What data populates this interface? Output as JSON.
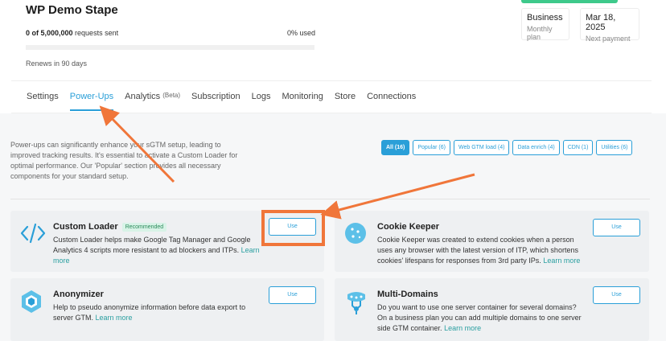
{
  "header": {
    "title": "WP Demo Stape",
    "requests_count": "0 of 5,000,000",
    "requests_suffix": " requests sent",
    "used": "0% used",
    "usage_percent": 0,
    "renews": "Renews in 90 days"
  },
  "plan_cards": [
    {
      "value": "Business",
      "label": "Monthly plan"
    },
    {
      "value": "Mar 18, 2025",
      "label": "Next payment"
    }
  ],
  "tabs": [
    {
      "label": "Settings",
      "active": false
    },
    {
      "label": "Power-Ups",
      "active": true
    },
    {
      "label": "Analytics",
      "sup": "(Beta)",
      "active": false
    },
    {
      "label": "Subscription",
      "active": false
    },
    {
      "label": "Logs",
      "active": false
    },
    {
      "label": "Monitoring",
      "active": false
    },
    {
      "label": "Store",
      "active": false
    },
    {
      "label": "Connections",
      "active": false
    }
  ],
  "intro": "Power-ups can significantly enhance your sGTM setup, leading to improved tracking results. It's essential to activate a Custom Loader for optimal performance. Our 'Popular' section provides all necessary components for your standard setup.",
  "filters": [
    {
      "label": "All (16)",
      "active": true
    },
    {
      "label": "Popular (6)",
      "active": false
    },
    {
      "label": "Web GTM load (4)",
      "active": false
    },
    {
      "label": "Data enrich (4)",
      "active": false
    },
    {
      "label": "CDN (1)",
      "active": false
    },
    {
      "label": "Utilities (6)",
      "active": false
    }
  ],
  "cards": [
    {
      "name": "Custom Loader",
      "badge": "Recommended",
      "desc": "Custom Loader helps make Google Tag Manager and Google Analytics 4 scripts more resistant to ad blockers and ITPs.",
      "learn_more": "Learn more",
      "button": "Use",
      "icon": "code-icon"
    },
    {
      "name": "Cookie Keeper",
      "desc": "Cookie Keeper was created to extend cookies when a person uses any browser with the latest version of ITP, which shortens cookies' lifespans for responses from 3rd party IPs.",
      "learn_more": "Learn more",
      "button": "Use",
      "icon": "cookie-icon"
    },
    {
      "name": "Anonymizer",
      "desc": "Help to pseudo anonymize information before data export to server GTM.",
      "learn_more": "Learn more",
      "button": "Use",
      "icon": "hexagon-icon"
    },
    {
      "name": "Multi-Domains",
      "desc": "Do you want to use one server container for several domains? On a business plan you can add multiple domains to one server side GTM container.",
      "learn_more": "Learn more",
      "button": "Use",
      "icon": "multi-domain-icon"
    }
  ],
  "colors": {
    "accent": "#2a9fd8",
    "annotation": "#f0763a",
    "green": "#3ec98b"
  }
}
